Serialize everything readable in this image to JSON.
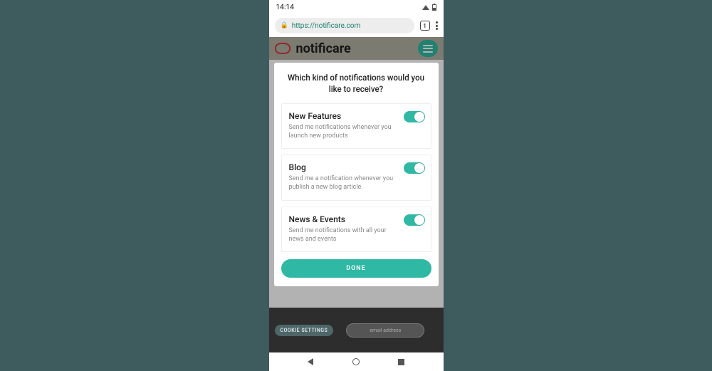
{
  "status": {
    "time": "14:14"
  },
  "browser": {
    "url": "https://notificare.com",
    "tab_count": "1"
  },
  "page": {
    "brand": "notificare",
    "cookie_label": "COOKIE SETTINGS",
    "email_placeholder": "email address"
  },
  "modal": {
    "title": "Which kind of notifications would you like to receive?",
    "prefs": [
      {
        "title": "New Features",
        "desc": "Send me notifications whenever you launch new products",
        "on": true
      },
      {
        "title": "Blog",
        "desc": "Send me a notification whenever you publish a new blog article",
        "on": true
      },
      {
        "title": "News & Events",
        "desc": "Send me notifications with all your news and events",
        "on": true
      }
    ],
    "done_label": "DONE"
  },
  "colors": {
    "accent": "#2fb8a3"
  }
}
